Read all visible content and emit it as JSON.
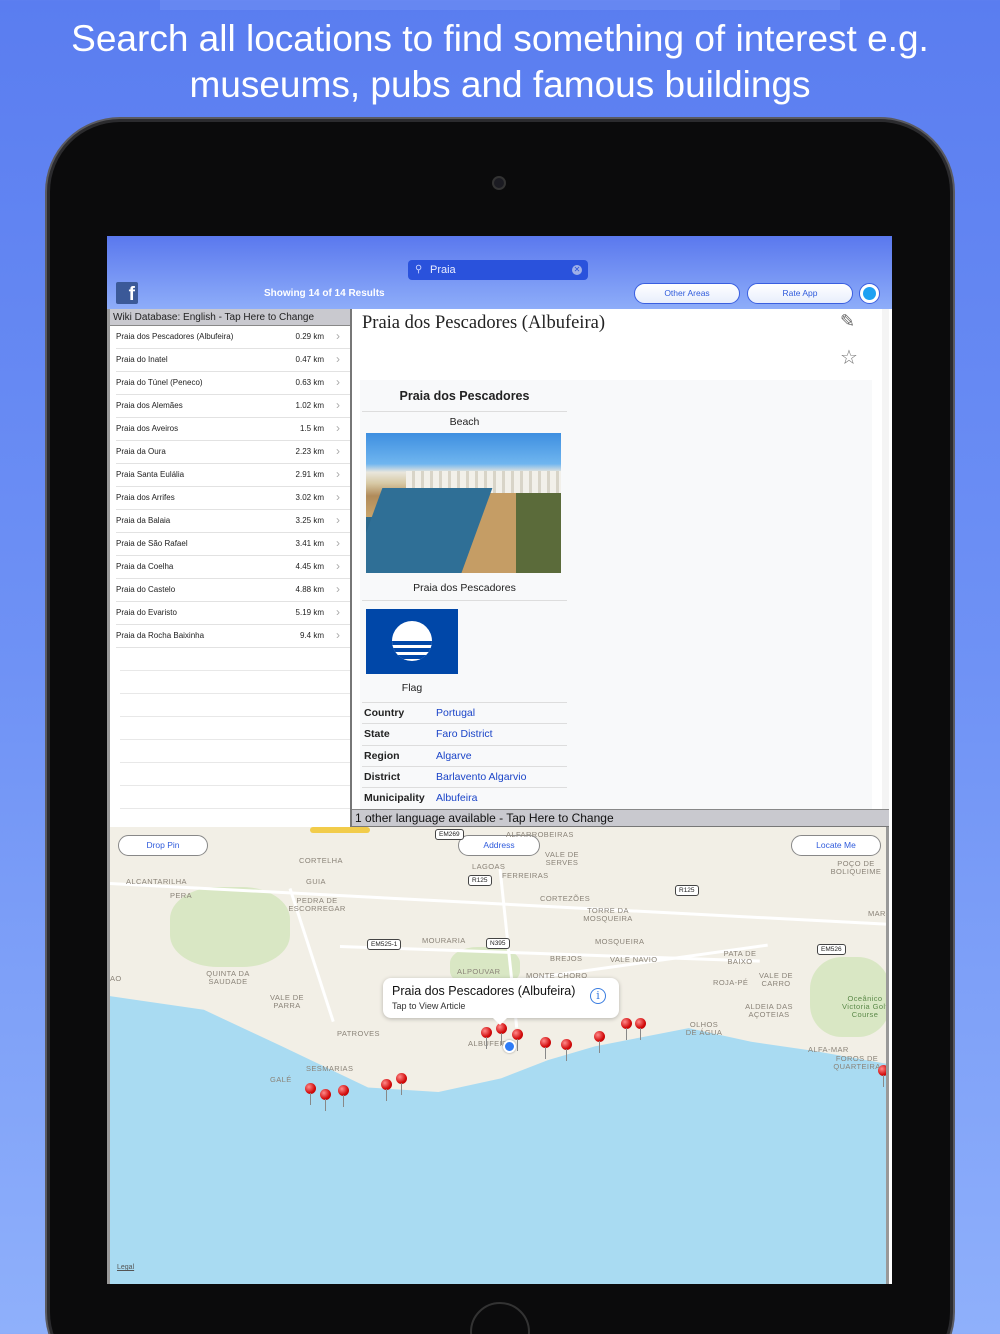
{
  "headline": {
    "line1": "Search all locations to find something of interest e.g.",
    "line2": "museums, pubs and famous buildings"
  },
  "topbar": {
    "facebook_glyph": "f",
    "search_value": "Praia",
    "results_text": "Showing 14 of 14 Results",
    "other_areas": "Other Areas",
    "rate_app": "Rate App"
  },
  "list": {
    "database_label": "Wiki Database: English - Tap Here to Change",
    "items": [
      {
        "name": "Praia dos Pescadores (Albufeira)",
        "distance": "0.29 km"
      },
      {
        "name": "Praia do Inatel",
        "distance": "0.47 km"
      },
      {
        "name": "Praia do Túnel (Peneco)",
        "distance": "0.63 km"
      },
      {
        "name": "Praia dos Alemães",
        "distance": "1.02 km"
      },
      {
        "name": "Praia dos Aveiros",
        "distance": "1.5 km"
      },
      {
        "name": "Praia da Oura",
        "distance": "2.23 km"
      },
      {
        "name": "Praia Santa Eulália",
        "distance": "2.91 km"
      },
      {
        "name": "Praia dos Arrifes",
        "distance": "3.02 km"
      },
      {
        "name": "Praia da Balaia",
        "distance": "3.25 km"
      },
      {
        "name": "Praia de São Rafael",
        "distance": "3.41 km"
      },
      {
        "name": "Praia da Coelha",
        "distance": "4.45 km"
      },
      {
        "name": "Praia do Castelo",
        "distance": "4.88 km"
      },
      {
        "name": "Praia do Evaristo",
        "distance": "5.19 km"
      },
      {
        "name": "Praia da Rocha Baixinha",
        "distance": "9.4 km"
      }
    ]
  },
  "article": {
    "title": "Praia dos Pescadores (Albufeira)",
    "infobox_title": "Praia dos Pescadores",
    "infobox_type": "Beach",
    "image_caption": "Praia dos Pescadores",
    "flag_caption": "Flag",
    "fields": [
      {
        "key": "Country",
        "value": "Portugal"
      },
      {
        "key": "State",
        "value": "Faro District"
      },
      {
        "key": "Region",
        "value": "Algarve"
      },
      {
        "key": "District",
        "value": "Barlavento Algarvio"
      },
      {
        "key": "Municipality",
        "value": "Albufeira"
      }
    ],
    "language_bar": "1 other language available - Tap Here to Change"
  },
  "map": {
    "drop_pin": "Drop Pin",
    "address": "Address",
    "locate_me": "Locate Me",
    "callout_title": "Praia dos Pescadores (Albufeira)",
    "callout_subtitle": "Tap to View Article",
    "info_glyph": "i",
    "legal": "Legal",
    "places": [
      "CORTELHA",
      "ALCANTARILHA",
      "GUIA",
      "PERA",
      "PEDRA DE ESCORREGAR",
      "LAGOAS",
      "FERREIRAS",
      "VALE DE SERVES",
      "ALFARROBEIRAS",
      "CORTEZÕES",
      "TORRE DA MOSQUEIRA",
      "MOURARIA",
      "MOSQUEIRA",
      "POÇO DE BOLIQUEIME",
      "MAR",
      "QUINTA DA SAUDADE",
      "VALE DE PARRA",
      "ALPOUVAR",
      "BREJOS",
      "VALE NAVIO",
      "PATA DE BAIXO",
      "ROJA-PÉ",
      "VALE DE CARRO",
      "MONTE CHORO",
      "PATROVES",
      "ALDEIA DAS AÇOTEIAS",
      "OLHOS DE ÁGUA",
      "SESMARIAS",
      "GALÉ",
      "ALBUFEIRA",
      "ALFA-MAR",
      "FOROS DE QUARTEIRA",
      "Oceânico Victoria Golf Course",
      "AO"
    ],
    "roads": [
      "EM269",
      "R125",
      "R125",
      "EM525-1",
      "N395",
      "EM526"
    ]
  },
  "colors": {
    "accent": "#2f5bdc",
    "pin": "#d20b0b",
    "link": "#1a44c8",
    "sea": "#a9dbf2"
  }
}
